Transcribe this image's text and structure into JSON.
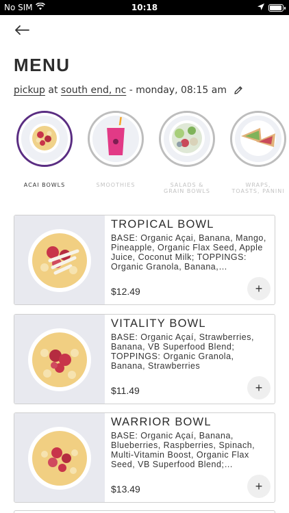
{
  "status_bar": {
    "carrier": "No SIM",
    "time": "10:18"
  },
  "header": {
    "title": "MENU"
  },
  "order": {
    "mode": "pickup",
    "at": "at",
    "location": "south end, nc",
    "datetime": "- monday, 08:15 am"
  },
  "categories": [
    {
      "line1": "ACAI BOWLS",
      "line2": "",
      "active": true
    },
    {
      "line1": "SMOOTHIES",
      "line2": "",
      "active": false
    },
    {
      "line1": "SALADS &",
      "line2": "GRAIN BOWLS",
      "active": false
    },
    {
      "line1": "WRAPS,",
      "line2": "TOASTS, PANINI",
      "active": false
    }
  ],
  "items": [
    {
      "name": "TROPICAL BOWL",
      "description": "BASE: Organic Açai, Banana, Mango, Pineapple, Organic Flax Seed, Apple Juice, Coconut Milk; TOPPINGS: Organic Granola, Banana, Strawberries, Coconut",
      "price": "$12.49"
    },
    {
      "name": "VITALITY BOWL",
      "description": "BASE: Organic Açaí, Strawberries, Banana, VB Superfood Blend; TOPPINGS: Organic Granola, Banana, Strawberries",
      "price": "$11.49"
    },
    {
      "name": "WARRIOR BOWL",
      "description": "BASE: Organic Açaí, Banana, Blueberries, Raspberries, Spinach, Multi-Vitamin Boost, Organic Flax Seed, VB Superfood Blend; TOPPINGS: Granola",
      "price": "$13.49"
    }
  ],
  "add_symbol": "+",
  "colors": {
    "accent_ring": "#5a2d82",
    "inactive_ring": "#bdbdbd"
  }
}
